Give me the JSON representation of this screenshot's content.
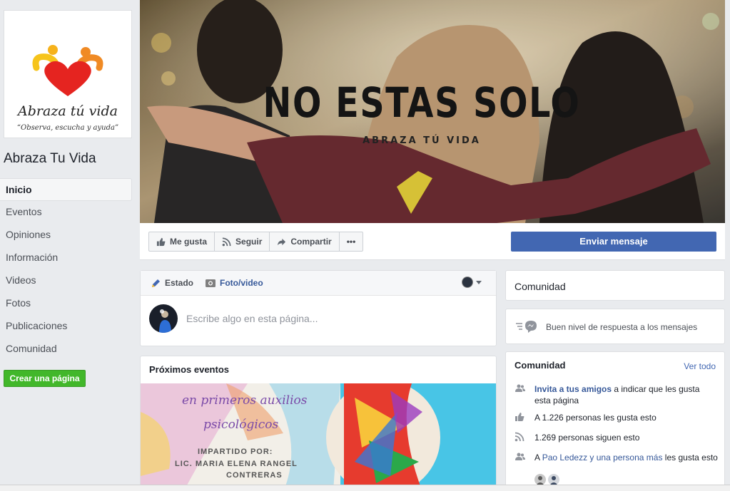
{
  "page": {
    "name": "Abraza Tu Vida",
    "logo_text": "Abraza tú vida",
    "logo_tagline": "“Observa, escucha y ayuda”"
  },
  "nav": {
    "items": [
      "Inicio",
      "Eventos",
      "Opiniones",
      "Información",
      "Videos",
      "Fotos",
      "Publicaciones",
      "Comunidad"
    ],
    "active": "Inicio",
    "create_page": "Crear una página"
  },
  "cover": {
    "title": "NO ESTAS SOLO",
    "subtitle": "ABRAZA TÚ VIDA"
  },
  "actions": {
    "like": "Me gusta",
    "follow": "Seguir",
    "share": "Compartir",
    "more": "•••",
    "send_message": "Enviar mensaje"
  },
  "composer": {
    "tab_status": "Estado",
    "tab_photo": "Foto/video",
    "placeholder": "Escribe algo en esta página..."
  },
  "events": {
    "title": "Próximos eventos",
    "image_lines": [
      "en primeros auxilios",
      "psicológicos",
      "IMPARTIDO POR:",
      "LIC. MARIA ELENA RANGEL",
      "CONTRERAS"
    ]
  },
  "sidebar": {
    "community_tab": "Comunidad",
    "response": "Buen nivel de respuesta a los mensajes",
    "community_title": "Comunidad",
    "see_all": "Ver todo",
    "invite_link": "Invita a tus amigos",
    "invite_rest": " a indicar que les gusta esta página",
    "likes": "A 1.226 personas les gusta esto",
    "follows": "1.269 personas siguen esto",
    "friends_prefix": "A ",
    "friends_link": "Pao Ledezz y una persona más",
    "friends_suffix": " les gusta esto"
  },
  "colors": {
    "brand_blue": "#4267b2",
    "green": "#42b72a",
    "background": "#e9ebee"
  }
}
